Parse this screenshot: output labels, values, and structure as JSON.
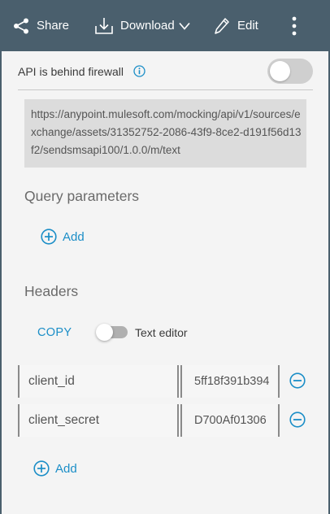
{
  "toolbar": {
    "share_label": "Share",
    "download_label": "Download",
    "edit_label": "Edit",
    "icons": [
      "share-icon",
      "download-icon",
      "chevron-down-icon",
      "pencil-icon",
      "more-vertical-icon"
    ],
    "background": "#4a5f6d"
  },
  "firewall": {
    "label": "API is behind firewall",
    "enabled": false
  },
  "endpoint_url": "https://anypoint.mulesoft.com/mocking/api/v1/sources/exchange/assets/31352752-2086-43f9-8ce2-d191f56d13f2/sendsmsapi100/1.0.0/m/text",
  "query_parameters": {
    "title": "Query parameters",
    "add_label": "Add"
  },
  "headers": {
    "title": "Headers",
    "copy_label": "COPY",
    "text_editor_label": "Text editor",
    "text_editor_enabled": false,
    "rows": [
      {
        "name": "client_id",
        "value": "5ff18f391b394"
      },
      {
        "name": "client_secret",
        "value": "D700Af01306"
      }
    ],
    "add_label": "Add"
  },
  "colors": {
    "accent": "#1b8ec7",
    "panel": "#f4f4f4",
    "url_box": "#dcdcdc"
  }
}
